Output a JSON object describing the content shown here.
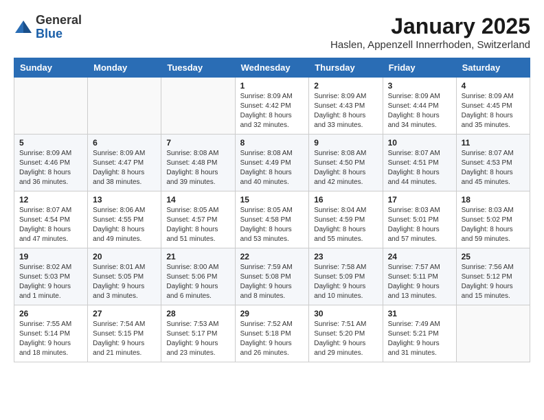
{
  "logo": {
    "general": "General",
    "blue": "Blue"
  },
  "header": {
    "month": "January 2025",
    "location": "Haslen, Appenzell Innerrhoden, Switzerland"
  },
  "weekdays": [
    "Sunday",
    "Monday",
    "Tuesday",
    "Wednesday",
    "Thursday",
    "Friday",
    "Saturday"
  ],
  "weeks": [
    [
      {
        "day": "",
        "sunrise": "",
        "sunset": "",
        "daylight": ""
      },
      {
        "day": "",
        "sunrise": "",
        "sunset": "",
        "daylight": ""
      },
      {
        "day": "",
        "sunrise": "",
        "sunset": "",
        "daylight": ""
      },
      {
        "day": "1",
        "sunrise": "Sunrise: 8:09 AM",
        "sunset": "Sunset: 4:42 PM",
        "daylight": "Daylight: 8 hours and 32 minutes."
      },
      {
        "day": "2",
        "sunrise": "Sunrise: 8:09 AM",
        "sunset": "Sunset: 4:43 PM",
        "daylight": "Daylight: 8 hours and 33 minutes."
      },
      {
        "day": "3",
        "sunrise": "Sunrise: 8:09 AM",
        "sunset": "Sunset: 4:44 PM",
        "daylight": "Daylight: 8 hours and 34 minutes."
      },
      {
        "day": "4",
        "sunrise": "Sunrise: 8:09 AM",
        "sunset": "Sunset: 4:45 PM",
        "daylight": "Daylight: 8 hours and 35 minutes."
      }
    ],
    [
      {
        "day": "5",
        "sunrise": "Sunrise: 8:09 AM",
        "sunset": "Sunset: 4:46 PM",
        "daylight": "Daylight: 8 hours and 36 minutes."
      },
      {
        "day": "6",
        "sunrise": "Sunrise: 8:09 AM",
        "sunset": "Sunset: 4:47 PM",
        "daylight": "Daylight: 8 hours and 38 minutes."
      },
      {
        "day": "7",
        "sunrise": "Sunrise: 8:08 AM",
        "sunset": "Sunset: 4:48 PM",
        "daylight": "Daylight: 8 hours and 39 minutes."
      },
      {
        "day": "8",
        "sunrise": "Sunrise: 8:08 AM",
        "sunset": "Sunset: 4:49 PM",
        "daylight": "Daylight: 8 hours and 40 minutes."
      },
      {
        "day": "9",
        "sunrise": "Sunrise: 8:08 AM",
        "sunset": "Sunset: 4:50 PM",
        "daylight": "Daylight: 8 hours and 42 minutes."
      },
      {
        "day": "10",
        "sunrise": "Sunrise: 8:07 AM",
        "sunset": "Sunset: 4:51 PM",
        "daylight": "Daylight: 8 hours and 44 minutes."
      },
      {
        "day": "11",
        "sunrise": "Sunrise: 8:07 AM",
        "sunset": "Sunset: 4:53 PM",
        "daylight": "Daylight: 8 hours and 45 minutes."
      }
    ],
    [
      {
        "day": "12",
        "sunrise": "Sunrise: 8:07 AM",
        "sunset": "Sunset: 4:54 PM",
        "daylight": "Daylight: 8 hours and 47 minutes."
      },
      {
        "day": "13",
        "sunrise": "Sunrise: 8:06 AM",
        "sunset": "Sunset: 4:55 PM",
        "daylight": "Daylight: 8 hours and 49 minutes."
      },
      {
        "day": "14",
        "sunrise": "Sunrise: 8:05 AM",
        "sunset": "Sunset: 4:57 PM",
        "daylight": "Daylight: 8 hours and 51 minutes."
      },
      {
        "day": "15",
        "sunrise": "Sunrise: 8:05 AM",
        "sunset": "Sunset: 4:58 PM",
        "daylight": "Daylight: 8 hours and 53 minutes."
      },
      {
        "day": "16",
        "sunrise": "Sunrise: 8:04 AM",
        "sunset": "Sunset: 4:59 PM",
        "daylight": "Daylight: 8 hours and 55 minutes."
      },
      {
        "day": "17",
        "sunrise": "Sunrise: 8:03 AM",
        "sunset": "Sunset: 5:01 PM",
        "daylight": "Daylight: 8 hours and 57 minutes."
      },
      {
        "day": "18",
        "sunrise": "Sunrise: 8:03 AM",
        "sunset": "Sunset: 5:02 PM",
        "daylight": "Daylight: 8 hours and 59 minutes."
      }
    ],
    [
      {
        "day": "19",
        "sunrise": "Sunrise: 8:02 AM",
        "sunset": "Sunset: 5:03 PM",
        "daylight": "Daylight: 9 hours and 1 minute."
      },
      {
        "day": "20",
        "sunrise": "Sunrise: 8:01 AM",
        "sunset": "Sunset: 5:05 PM",
        "daylight": "Daylight: 9 hours and 3 minutes."
      },
      {
        "day": "21",
        "sunrise": "Sunrise: 8:00 AM",
        "sunset": "Sunset: 5:06 PM",
        "daylight": "Daylight: 9 hours and 6 minutes."
      },
      {
        "day": "22",
        "sunrise": "Sunrise: 7:59 AM",
        "sunset": "Sunset: 5:08 PM",
        "daylight": "Daylight: 9 hours and 8 minutes."
      },
      {
        "day": "23",
        "sunrise": "Sunrise: 7:58 AM",
        "sunset": "Sunset: 5:09 PM",
        "daylight": "Daylight: 9 hours and 10 minutes."
      },
      {
        "day": "24",
        "sunrise": "Sunrise: 7:57 AM",
        "sunset": "Sunset: 5:11 PM",
        "daylight": "Daylight: 9 hours and 13 minutes."
      },
      {
        "day": "25",
        "sunrise": "Sunrise: 7:56 AM",
        "sunset": "Sunset: 5:12 PM",
        "daylight": "Daylight: 9 hours and 15 minutes."
      }
    ],
    [
      {
        "day": "26",
        "sunrise": "Sunrise: 7:55 AM",
        "sunset": "Sunset: 5:14 PM",
        "daylight": "Daylight: 9 hours and 18 minutes."
      },
      {
        "day": "27",
        "sunrise": "Sunrise: 7:54 AM",
        "sunset": "Sunset: 5:15 PM",
        "daylight": "Daylight: 9 hours and 21 minutes."
      },
      {
        "day": "28",
        "sunrise": "Sunrise: 7:53 AM",
        "sunset": "Sunset: 5:17 PM",
        "daylight": "Daylight: 9 hours and 23 minutes."
      },
      {
        "day": "29",
        "sunrise": "Sunrise: 7:52 AM",
        "sunset": "Sunset: 5:18 PM",
        "daylight": "Daylight: 9 hours and 26 minutes."
      },
      {
        "day": "30",
        "sunrise": "Sunrise: 7:51 AM",
        "sunset": "Sunset: 5:20 PM",
        "daylight": "Daylight: 9 hours and 29 minutes."
      },
      {
        "day": "31",
        "sunrise": "Sunrise: 7:49 AM",
        "sunset": "Sunset: 5:21 PM",
        "daylight": "Daylight: 9 hours and 31 minutes."
      },
      {
        "day": "",
        "sunrise": "",
        "sunset": "",
        "daylight": ""
      }
    ]
  ]
}
